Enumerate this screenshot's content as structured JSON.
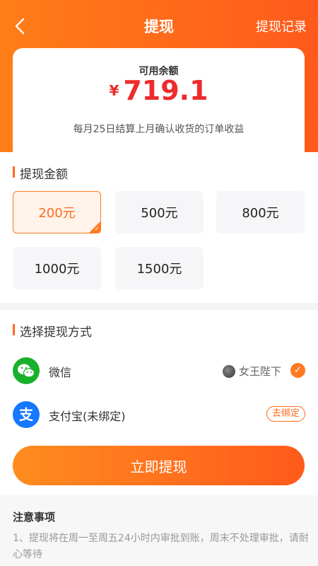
{
  "nav": {
    "title": "提现",
    "right_label": "提现记录"
  },
  "balance": {
    "label": "可用余额",
    "currency": "¥",
    "amount": "719.1",
    "note": "每月25日结算上月确认收货的订单收益"
  },
  "amount_section": {
    "title": "提现金额",
    "options": [
      "200元",
      "500元",
      "800元",
      "1000元",
      "1500元"
    ],
    "selected": "200元"
  },
  "method_section": {
    "title": "选择提现方式",
    "methods": [
      {
        "name": "微信",
        "user": "女王陛下",
        "selected": true,
        "icon": "wechat-icon"
      },
      {
        "name": "支付宝(未绑定)",
        "action": "去绑定",
        "icon": "alipay-icon"
      }
    ]
  },
  "submit_label": "立即提现",
  "notice": {
    "title": "注意事项",
    "text": "1、提现将在周一至周五24小时内审批到账，周末不处理审批，请耐心等待"
  },
  "colors": {
    "accent": "#ff6a1c",
    "amount_red": "#ee2b2b",
    "wechat": "#19b02b",
    "alipay": "#1677ff"
  }
}
